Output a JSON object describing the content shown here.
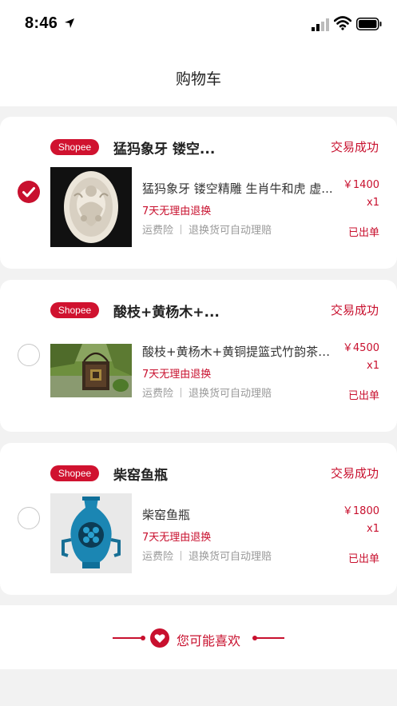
{
  "status_bar": {
    "time": "8:46"
  },
  "nav": {
    "title": "购物车"
  },
  "orders": [
    {
      "platform": "Shopee",
      "shop_name": "猛犸象牙 镂空...",
      "status": "交易成功",
      "selected": true,
      "item_title": "猛犸象牙 镂空精雕 生肖牛和虎 虚...",
      "return_policy": "7天无理由退换",
      "service_1": "运费险",
      "service_2": "退换货可自动理赔",
      "price": "￥1400",
      "quantity": "x1",
      "shipped": "已出单",
      "image": "carved-ivory-medallion"
    },
    {
      "platform": "Shopee",
      "shop_name": "酸枝+黄杨木+...",
      "status": "交易成功",
      "selected": false,
      "item_title": "酸枝+黄杨木+黄铜提篮式竹韵茶笼...",
      "return_policy": "7天无理由退换",
      "service_1": "运费险",
      "service_2": "退换货可自动理赔",
      "price": "￥4500",
      "quantity": "x1",
      "shipped": "已出单",
      "image": "wooden-tea-basket"
    },
    {
      "platform": "Shopee",
      "shop_name": "柴窑鱼瓶",
      "status": "交易成功",
      "selected": false,
      "item_title": "柴窑鱼瓶",
      "return_policy": "7天无理由退换",
      "service_1": "运费险",
      "service_2": "退换货可自动理赔",
      "price": "￥1800",
      "quantity": "x1",
      "shipped": "已出单",
      "image": "blue-fish-vase"
    }
  ],
  "recommend": {
    "label": "您可能喜欢",
    "icon": "heart-icon"
  },
  "colors": {
    "accent": "#c8102e",
    "background": "#f2f2f2"
  }
}
